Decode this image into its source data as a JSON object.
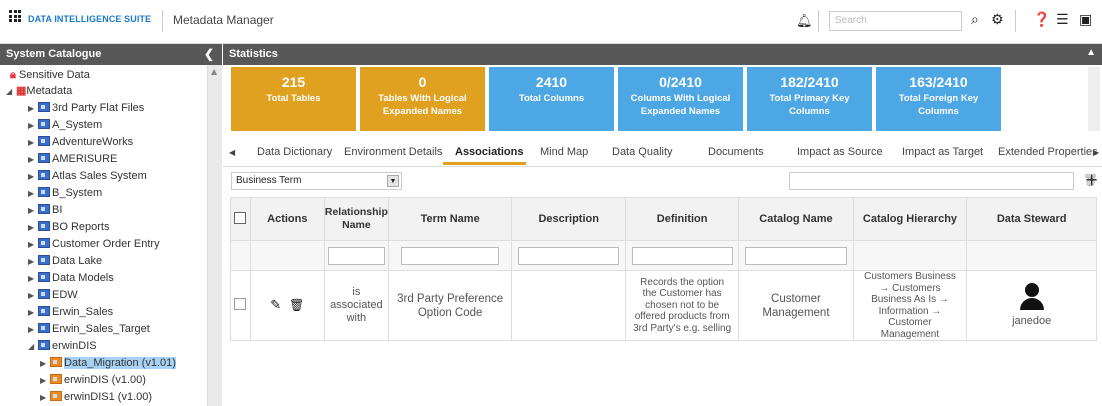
{
  "header": {
    "suite": "DATA INTELLIGENCE SUITE",
    "module": "Metadata Manager",
    "search_placeholder": "Search",
    "icons": [
      "bell-icon",
      "search-icon",
      "gear-icon",
      "help-icon",
      "news-icon",
      "book-icon"
    ]
  },
  "left_panel": {
    "title": "System Catalogue",
    "tree": [
      {
        "label": "Sensitive Data",
        "icon": "lock-icon"
      },
      {
        "label": "Metadata",
        "icon": "grid-icon"
      },
      {
        "label": "3rd Party Flat Files"
      },
      {
        "label": "A_System"
      },
      {
        "label": "AdventureWorks"
      },
      {
        "label": "AMERISURE"
      },
      {
        "label": "Atlas Sales System"
      },
      {
        "label": "B_System"
      },
      {
        "label": "BI"
      },
      {
        "label": "BO Reports"
      },
      {
        "label": "Customer Order Entry"
      },
      {
        "label": "Data Lake"
      },
      {
        "label": "Data Models"
      },
      {
        "label": "EDW"
      },
      {
        "label": "Erwin_Sales"
      },
      {
        "label": "Erwin_Sales_Target"
      },
      {
        "label": "erwinDIS"
      },
      {
        "label": "Data_Migration (v1.01)",
        "selected": true
      },
      {
        "label": "erwinDIS (v1.00)"
      },
      {
        "label": "erwinDIS1 (v1.00)"
      }
    ]
  },
  "right_panel": {
    "title": "Statistics",
    "stats": [
      {
        "value": "215",
        "label": "Total Tables",
        "color": "#e0a020"
      },
      {
        "value": "0",
        "label": "Tables With Logical Expanded Names",
        "color": "#e0a020"
      },
      {
        "value": "2410",
        "label": "Total Columns",
        "color": "#4ea7e5"
      },
      {
        "value": "0/2410",
        "label": "Columns With Logical Expanded Names",
        "color": "#4ea7e5"
      },
      {
        "value": "182/2410",
        "label": "Total Primary Key Columns",
        "color": "#4ea7e5"
      },
      {
        "value": "163/2410",
        "label": "Total Foreign Key Columns",
        "color": "#4ea7e5"
      }
    ],
    "tabs": [
      "Data Dictionary",
      "Environment Details",
      "Associations",
      "Mind Map",
      "Data Quality",
      "Documents",
      "Impact as Source",
      "Impact as Target",
      "Extended Properties"
    ],
    "active_tab": "Associations",
    "type_select": "Business Term",
    "columns": [
      "Actions",
      "Relationship Name",
      "Term Name",
      "Description",
      "Definition",
      "Catalog Name",
      "Catalog Hierarchy",
      "Data Steward"
    ],
    "row": {
      "relationship": "is associated with",
      "term_name": "3rd Party Preference Option Code",
      "description": "",
      "definition": "Records the option the Customer has chosen not to be offered products from 3rd Party's e.g. selling",
      "catalog_name": "Customer Management",
      "catalog_hierarchy": "Customers Business → Customers Business As Is → Information → Customer Management",
      "data_steward": "janedoe"
    }
  }
}
